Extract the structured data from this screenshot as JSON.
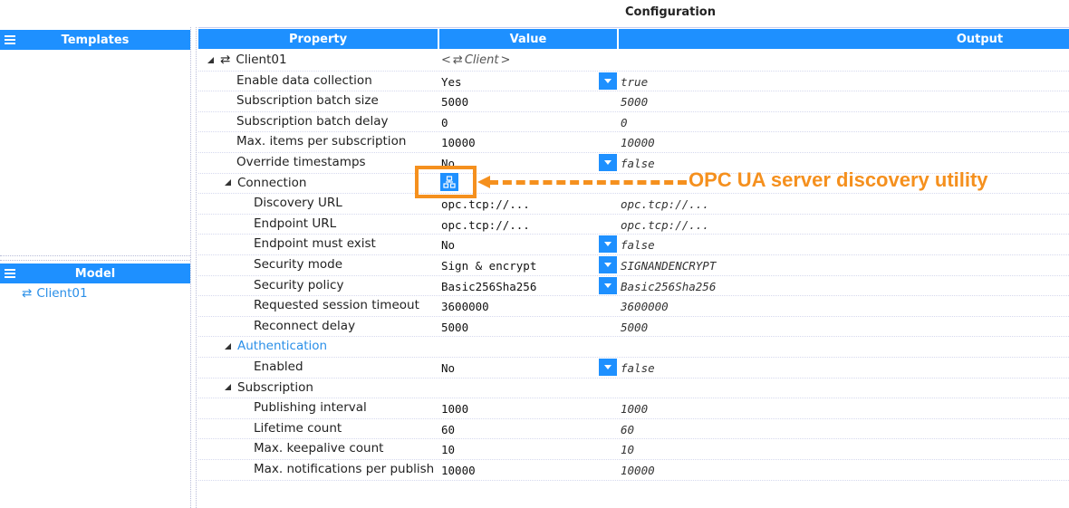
{
  "title": "Configuration",
  "templates_panel": {
    "title": "Templates",
    "menu_icon": "hamburger-icon"
  },
  "model_panel": {
    "title": "Model",
    "menu_icon": "hamburger-icon",
    "items": [
      {
        "label": "Client01",
        "icon": "client-exchange-icon"
      }
    ]
  },
  "grid": {
    "columns": {
      "property": "Property",
      "value": "Value",
      "output": "Output"
    },
    "root": {
      "label": "Client01",
      "type_label": "Client",
      "icon": "client-exchange-icon"
    },
    "rows": [
      {
        "label": "Enable data collection",
        "value": "Yes",
        "output": "true",
        "dropdown": true
      },
      {
        "label": "Subscription batch size",
        "value": "5000",
        "output": "5000",
        "dropdown": false
      },
      {
        "label": "Subscription batch delay",
        "value": "0",
        "output": "0",
        "dropdown": false
      },
      {
        "label": "Max. items per subscription",
        "value": "10000",
        "output": "10000",
        "dropdown": false
      },
      {
        "label": "Override timestamps",
        "value": "No",
        "output": "false",
        "dropdown": true
      },
      {
        "label": "Connection",
        "group": true
      },
      {
        "label": "Discovery URL",
        "value": "opc.tcp://...",
        "output": "opc.tcp://...",
        "dropdown": false
      },
      {
        "label": "Endpoint URL",
        "value": "opc.tcp://...",
        "output": "opc.tcp://...",
        "dropdown": false
      },
      {
        "label": "Endpoint must exist",
        "value": "No",
        "output": "false",
        "dropdown": true
      },
      {
        "label": "Security mode",
        "value": "Sign & encrypt",
        "output": "SIGNANDENCRYPT",
        "dropdown": true
      },
      {
        "label": "Security policy",
        "value": "Basic256Sha256",
        "output": "Basic256Sha256",
        "dropdown": true
      },
      {
        "label": "Requested session timeout",
        "value": "3600000",
        "output": "3600000",
        "dropdown": false
      },
      {
        "label": "Reconnect delay",
        "value": "5000",
        "output": "5000",
        "dropdown": false
      },
      {
        "label": "Authentication",
        "group": true,
        "link": true
      },
      {
        "label": "Enabled",
        "value": "No",
        "output": "false",
        "dropdown": true
      },
      {
        "label": "Subscription",
        "group": true
      },
      {
        "label": "Publishing interval",
        "value": "1000",
        "output": "1000",
        "dropdown": false
      },
      {
        "label": "Lifetime count",
        "value": "60",
        "output": "60",
        "dropdown": false
      },
      {
        "label": "Max. keepalive count",
        "value": "10",
        "output": "10",
        "dropdown": false
      },
      {
        "label": "Max. notifications per publish",
        "value": "10000",
        "output": "10000",
        "dropdown": false
      }
    ]
  },
  "annotation": {
    "text": "OPC UA server discovery utility",
    "color": "#f5901e",
    "button_icon": "network-discovery-icon"
  },
  "colors": {
    "accent": "#1e90ff",
    "link": "#2a8fe8"
  }
}
